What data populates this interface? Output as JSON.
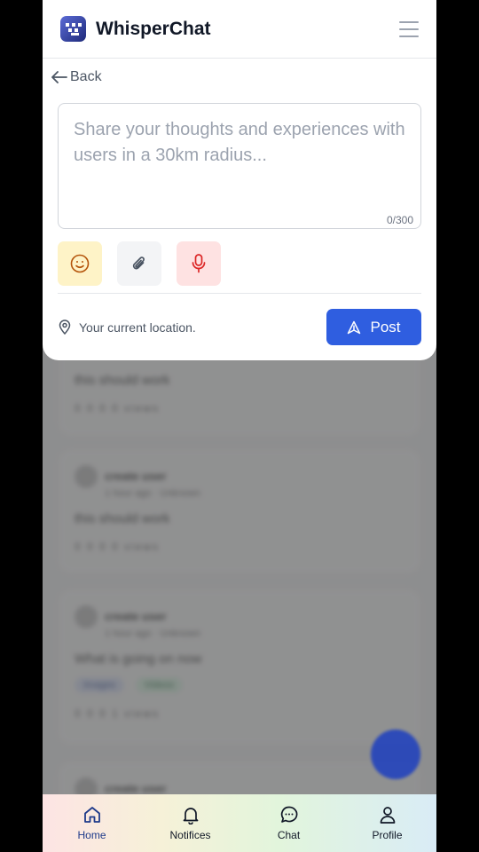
{
  "header": {
    "app_title": "WhisperChat",
    "logo_icon": "logo-icon",
    "menu_icon": "hamburger-menu-icon"
  },
  "composer": {
    "back_label": "Back",
    "placeholder": "Share your thoughts and experiences with users in a 30km radius...",
    "counter": "0/300",
    "tools": [
      {
        "name": "emoji",
        "icon": "smiley-icon",
        "color": "#fef3c7"
      },
      {
        "name": "attach",
        "icon": "paperclip-icon",
        "color": "#f3f4f6"
      },
      {
        "name": "mic",
        "icon": "microphone-icon",
        "color": "#fee2e2"
      }
    ],
    "location_text": "Your current location.",
    "post_label": "Post"
  },
  "feed": {
    "cards": [
      {
        "text": "this should work",
        "stats": "0  0  0  0 views"
      },
      {
        "name": "create user",
        "meta": "1 hour ago · Unknown",
        "text": "this should work",
        "stats": "0  0  0  0 views"
      },
      {
        "name": "create user",
        "meta": "1 hour ago · Unknown",
        "text": "What is going on now",
        "tags": [
          "Images",
          "Videos"
        ],
        "stats": "0  0  0  1 views"
      },
      {
        "name": "create user"
      }
    ]
  },
  "bottom_nav": {
    "items": [
      {
        "label": "Home",
        "icon": "home-icon",
        "active": true
      },
      {
        "label": "Notifices",
        "icon": "bell-icon",
        "active": false
      },
      {
        "label": "Chat",
        "icon": "chat-bubble-icon",
        "active": false
      },
      {
        "label": "Profile",
        "icon": "user-icon",
        "active": false
      }
    ]
  },
  "colors": {
    "accent": "#2f5ee0",
    "active_nav": "#1e3a8a"
  }
}
